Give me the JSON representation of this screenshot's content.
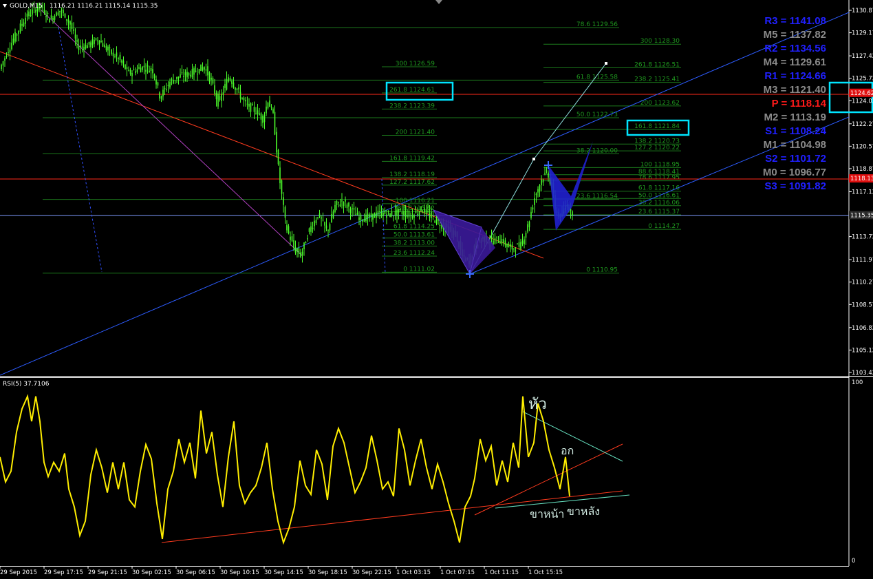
{
  "header": {
    "symbol": "GOLD,M15",
    "prices": "1116.21 1116.21 1115.14 1115.35",
    "rsi_label": "RSI(5) 37.7106"
  },
  "colors": {
    "background": "#000000",
    "candle": "#4cff2b",
    "fib": "#1c7a1c",
    "fib_text": "#1f9a1f",
    "channel": "#2d5cff",
    "resistance": "#ff2a1a",
    "trend": "#ff3b1e",
    "rsi": "#ffee00",
    "pattern": "#3b1a9a",
    "highlight": "#00e5ff"
  },
  "chart_data": [
    {
      "type": "candlestick",
      "title": "GOLD,M15",
      "ylim": [
        1103.42,
        1130.87
      ],
      "y_ticks": [
        "1130.87",
        "1129.17",
        "1127.42",
        "1125.72",
        "1124.02",
        "1122.27",
        "1120.57",
        "1118.87",
        "1117.12",
        "1115.42",
        "1113.72",
        "1111.97",
        "1110.27",
        "1108.57",
        "1106.82",
        "1105.12",
        "1103.42"
      ],
      "last_price": "1115.35",
      "price_marks": [
        "1124.62",
        "1118.13"
      ],
      "fib_a": [
        {
          "label": "300 1126.59",
          "y": 1126.59
        },
        {
          "label": "261.8 1124.61",
          "y": 1124.61
        },
        {
          "label": "238.2 1123.39",
          "y": 1123.39
        },
        {
          "label": "200 1121.40",
          "y": 1121.4
        },
        {
          "label": "161.8 1119.42",
          "y": 1119.42
        },
        {
          "label": "138.2 1118.19",
          "y": 1118.19
        },
        {
          "label": "127.2 1117.62",
          "y": 1117.62
        },
        {
          "label": "100 1116.21",
          "y": 1116.21
        },
        {
          "label": "78.6 1115.62",
          "y": 1115.62
        },
        {
          "label": "61.8 1114.25",
          "y": 1114.25
        },
        {
          "label": "50.0 1113.61",
          "y": 1113.61
        },
        {
          "label": "38.2 1113.00",
          "y": 1113.0
        },
        {
          "label": "23.6 1112.24",
          "y": 1112.24
        },
        {
          "label": "0 1111.02",
          "y": 1111.02
        }
      ],
      "fib_b": [
        {
          "label": "78.6 1129.56",
          "y": 1129.56
        },
        {
          "label": "61.8 1125.58",
          "y": 1125.58
        },
        {
          "label": "50.0 1122.73",
          "y": 1122.73
        },
        {
          "label": "38.2 1120.00",
          "y": 1120.0
        },
        {
          "label": "23.6 1116.54",
          "y": 1116.54
        },
        {
          "label": "0 1110.95",
          "y": 1110.95
        }
      ],
      "fib_c": [
        {
          "label": "300 1128.30",
          "y": 1128.3
        },
        {
          "label": "261.8 1126.51",
          "y": 1126.51
        },
        {
          "label": "238.2 1125.41",
          "y": 1125.41
        },
        {
          "label": "200 1123.62",
          "y": 1123.62
        },
        {
          "label": "161.8 1121.84",
          "y": 1121.84
        },
        {
          "label": "138.2 1120.73",
          "y": 1120.73
        },
        {
          "label": "127.2 1120.22",
          "y": 1120.22
        },
        {
          "label": "100 1118.95",
          "y": 1118.95
        },
        {
          "label": "88.6 1118.41",
          "y": 1118.41
        },
        {
          "label": "78.6 1117.95",
          "y": 1117.95
        },
        {
          "label": "61.8 1117.16",
          "y": 1117.16
        },
        {
          "label": "50.0 1116.61",
          "y": 1116.61
        },
        {
          "label": "38.2 1116.06",
          "y": 1116.06
        },
        {
          "label": "23.6 1115.37",
          "y": 1115.37
        },
        {
          "label": "0 1114.27",
          "y": 1114.27
        }
      ],
      "pivots": [
        {
          "label": "R3 = 1141.08",
          "color": "#2020ff"
        },
        {
          "label": "M5 = 1137.82",
          "color": "#8a8a8a"
        },
        {
          "label": "R2 = 1134.56",
          "color": "#2020ff"
        },
        {
          "label": "M4 = 1129.61",
          "color": "#8a8a8a"
        },
        {
          "label": "R1 = 1124.66",
          "color": "#2020ff"
        },
        {
          "label": "M3 = 1121.40",
          "color": "#8a8a8a"
        },
        {
          "label": "P  = 1118.14",
          "color": "#ff1a1a"
        },
        {
          "label": "M2 = 1113.19",
          "color": "#8a8a8a"
        },
        {
          "label": "S1 = 1108.24",
          "color": "#2020ff"
        },
        {
          "label": "M1 = 1104.98",
          "color": "#8a8a8a"
        },
        {
          "label": "S2 = 1101.72",
          "color": "#2020ff"
        },
        {
          "label": "M0 = 1096.77",
          "color": "#8a8a8a"
        },
        {
          "label": "S3 = 1091.82",
          "color": "#2020ff"
        }
      ],
      "price_path": [
        [
          0,
          1126.2
        ],
        [
          20,
          1128.5
        ],
        [
          40,
          1130.4
        ],
        [
          60,
          1131.2
        ],
        [
          75,
          1130.2
        ],
        [
          90,
          1130.9
        ],
        [
          105,
          1129.8
        ],
        [
          115,
          1128.1
        ],
        [
          130,
          1128.2
        ],
        [
          145,
          1128.7
        ],
        [
          160,
          1127.8
        ],
        [
          175,
          1127.2
        ],
        [
          190,
          1126.1
        ],
        [
          210,
          1126.6
        ],
        [
          225,
          1126.3
        ],
        [
          235,
          1124.3
        ],
        [
          250,
          1125.5
        ],
        [
          265,
          1125.9
        ],
        [
          280,
          1126.1
        ],
        [
          300,
          1126.6
        ],
        [
          310,
          1125.4
        ],
        [
          320,
          1123.8
        ],
        [
          335,
          1125.9
        ],
        [
          345,
          1125.0
        ],
        [
          360,
          1123.7
        ],
        [
          375,
          1123.2
        ],
        [
          385,
          1122.6
        ],
        [
          392,
          1124.1
        ],
        [
          400,
          1122.8
        ],
        [
          408,
          1118.4
        ],
        [
          418,
          1114.5
        ],
        [
          430,
          1112.8
        ],
        [
          440,
          1112.3
        ],
        [
          452,
          1114.2
        ],
        [
          465,
          1115.4
        ],
        [
          478,
          1114.1
        ],
        [
          490,
          1116.1
        ],
        [
          500,
          1116.4
        ],
        [
          512,
          1115.8
        ],
        [
          525,
          1115.1
        ],
        [
          540,
          1115.2
        ],
        [
          555,
          1115.5
        ],
        [
          570,
          1115.4
        ],
        [
          585,
          1115.6
        ],
        [
          600,
          1115.3
        ],
        [
          615,
          1115.8
        ],
        [
          630,
          1115.2
        ],
        [
          650,
          1114.4
        ],
        [
          665,
          1113.9
        ],
        [
          675,
          1112.1
        ],
        [
          685,
          1111.8
        ],
        [
          695,
          1113.2
        ],
        [
          705,
          1113.6
        ],
        [
          715,
          1113.4
        ],
        [
          730,
          1113.5
        ],
        [
          745,
          1112.8
        ],
        [
          760,
          1113.1
        ],
        [
          770,
          1114.6
        ],
        [
          780,
          1116.8
        ],
        [
          790,
          1118.1
        ],
        [
          798,
          1118.7
        ],
        [
          805,
          1117.4
        ],
        [
          810,
          1115.7
        ],
        [
          818,
          1115.1
        ],
        [
          826,
          1116.3
        ],
        [
          832,
          1115.6
        ]
      ]
    },
    {
      "type": "line",
      "title": "RSI(5) 37.7106",
      "ylim": [
        0,
        100
      ],
      "y_ticks": [
        "100",
        "0"
      ],
      "x_tick_labels": [
        "29 Sep 2015",
        "29 Sep 17:15",
        "29 Sep 21:15",
        "30 Sep 02:15",
        "30 Sep 06:15",
        "30 Sep 10:15",
        "30 Sep 14:15",
        "30 Sep 18:15",
        "30 Sep 22:15",
        "1 Oct 03:15",
        "1 Oct 07:15",
        "1 Oct 11:15",
        "1 Oct 15:15"
      ],
      "annotations": [
        "หัว",
        "อก",
        "ขาหน้า",
        "ขาหลัง"
      ],
      "rsi": [
        [
          0,
          58
        ],
        [
          8,
          44
        ],
        [
          16,
          50
        ],
        [
          24,
          72
        ],
        [
          32,
          85
        ],
        [
          40,
          92
        ],
        [
          46,
          78
        ],
        [
          52,
          92
        ],
        [
          58,
          78
        ],
        [
          64,
          55
        ],
        [
          70,
          47
        ],
        [
          78,
          55
        ],
        [
          86,
          50
        ],
        [
          94,
          60
        ],
        [
          100,
          40
        ],
        [
          108,
          30
        ],
        [
          116,
          14
        ],
        [
          124,
          22
        ],
        [
          132,
          48
        ],
        [
          140,
          62
        ],
        [
          148,
          52
        ],
        [
          156,
          38
        ],
        [
          164,
          55
        ],
        [
          172,
          40
        ],
        [
          180,
          55
        ],
        [
          188,
          34
        ],
        [
          196,
          30
        ],
        [
          204,
          50
        ],
        [
          212,
          65
        ],
        [
          220,
          57
        ],
        [
          228,
          32
        ],
        [
          236,
          12
        ],
        [
          244,
          40
        ],
        [
          252,
          50
        ],
        [
          260,
          68
        ],
        [
          268,
          55
        ],
        [
          276,
          66
        ],
        [
          284,
          46
        ],
        [
          292,
          84
        ],
        [
          300,
          60
        ],
        [
          308,
          72
        ],
        [
          316,
          48
        ],
        [
          324,
          30
        ],
        [
          332,
          58
        ],
        [
          340,
          78
        ],
        [
          348,
          42
        ],
        [
          356,
          32
        ],
        [
          364,
          38
        ],
        [
          372,
          42
        ],
        [
          380,
          52
        ],
        [
          388,
          66
        ],
        [
          396,
          40
        ],
        [
          404,
          22
        ],
        [
          412,
          10
        ],
        [
          420,
          18
        ],
        [
          428,
          30
        ],
        [
          436,
          56
        ],
        [
          444,
          42
        ],
        [
          452,
          37
        ],
        [
          460,
          62
        ],
        [
          468,
          54
        ],
        [
          476,
          34
        ],
        [
          484,
          64
        ],
        [
          492,
          74
        ],
        [
          500,
          66
        ],
        [
          508,
          52
        ],
        [
          516,
          38
        ],
        [
          524,
          44
        ],
        [
          532,
          52
        ],
        [
          540,
          70
        ],
        [
          548,
          56
        ],
        [
          556,
          40
        ],
        [
          564,
          44
        ],
        [
          572,
          36
        ],
        [
          580,
          74
        ],
        [
          588,
          62
        ],
        [
          596,
          42
        ],
        [
          604,
          56
        ],
        [
          612,
          68
        ],
        [
          620,
          52
        ],
        [
          628,
          40
        ],
        [
          636,
          54
        ],
        [
          644,
          44
        ],
        [
          652,
          32
        ],
        [
          660,
          22
        ],
        [
          668,
          10
        ],
        [
          676,
          30
        ],
        [
          684,
          36
        ],
        [
          690,
          46
        ],
        [
          698,
          68
        ],
        [
          706,
          56
        ],
        [
          714,
          64
        ],
        [
          722,
          42
        ],
        [
          730,
          56
        ],
        [
          738,
          44
        ],
        [
          746,
          66
        ],
        [
          754,
          52
        ],
        [
          760,
          92
        ],
        [
          768,
          58
        ],
        [
          776,
          66
        ],
        [
          782,
          88
        ],
        [
          790,
          78
        ],
        [
          798,
          62
        ],
        [
          806,
          52
        ],
        [
          814,
          40
        ],
        [
          822,
          58
        ],
        [
          828,
          36
        ]
      ]
    }
  ]
}
